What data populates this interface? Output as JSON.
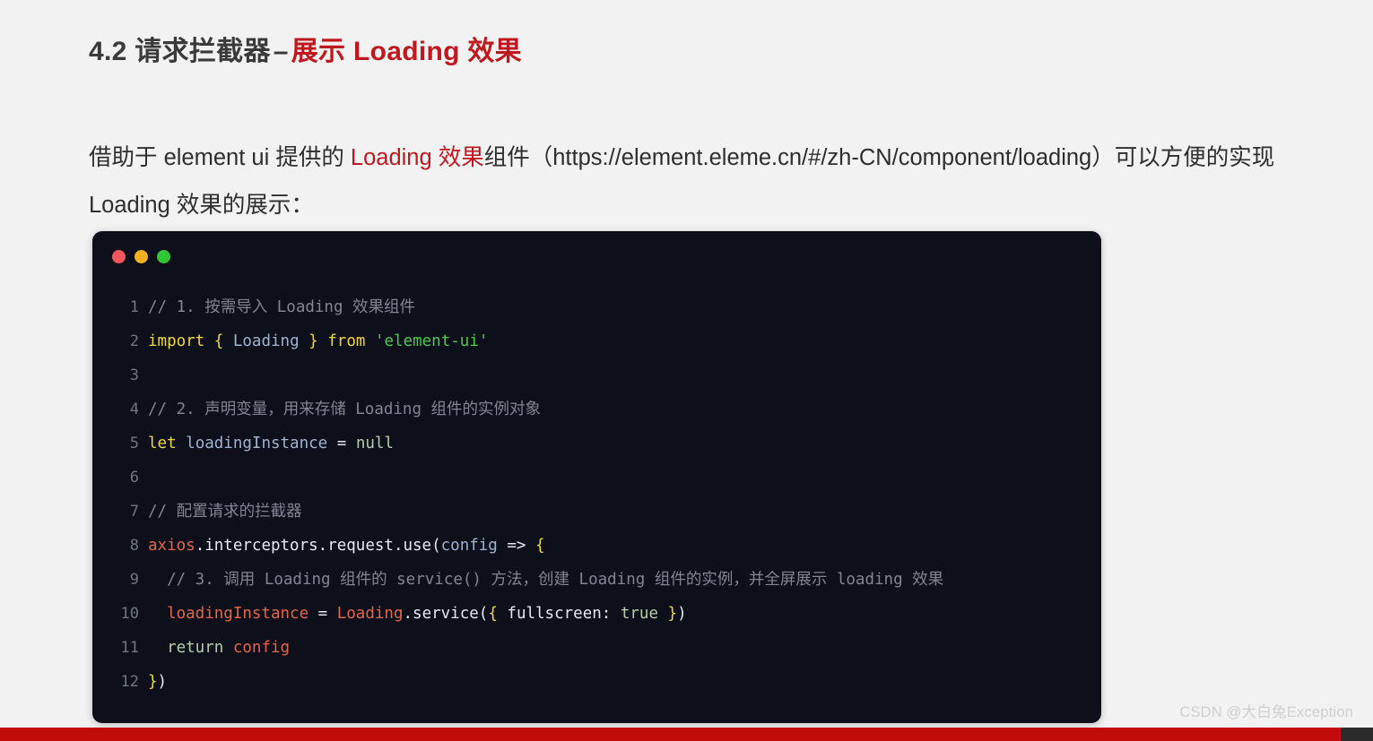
{
  "page": {
    "background_color": "#f2f2f2",
    "accent_color": "#c0181f"
  },
  "heading": {
    "prefix": "4.2 请求拦截器",
    "dash": "–",
    "accent": "展示 Loading 效果"
  },
  "paragraph": {
    "part1": "借助于 element ui 提供的 ",
    "accent": "Loading 效果",
    "part2": "组件（https://element.eleme.cn/#/zh-CN/component/loading）可以方便的实现 Loading 效果的展示：",
    "url": "https://element.eleme.cn/#/zh-CN/component/loading"
  },
  "code_card": {
    "background_color": "#0d101b",
    "window_dots": [
      {
        "name": "close-dot",
        "color": "#f2565c"
      },
      {
        "name": "minimize-dot",
        "color": "#f5b01f"
      },
      {
        "name": "maximize-dot",
        "color": "#2fc636"
      }
    ],
    "language": "javascript",
    "lines": [
      {
        "n": "1",
        "text": "// 1. 按需导入 Loading 效果组件"
      },
      {
        "n": "2",
        "text": "import { Loading } from 'element-ui'"
      },
      {
        "n": "3",
        "text": ""
      },
      {
        "n": "4",
        "text": "// 2. 声明变量，用来存储 Loading 组件的实例对象"
      },
      {
        "n": "5",
        "text": "let loadingInstance = null"
      },
      {
        "n": "6",
        "text": ""
      },
      {
        "n": "7",
        "text": "// 配置请求的拦截器"
      },
      {
        "n": "8",
        "text": "axios.interceptors.request.use(config => {"
      },
      {
        "n": "9",
        "text": "  // 3. 调用 Loading 组件的 service() 方法，创建 Loading 组件的实例，并全屏展示 loading 效果"
      },
      {
        "n": "10",
        "text": "  loadingInstance = Loading.service({ fullscreen: true })"
      },
      {
        "n": "11",
        "text": "  return config"
      },
      {
        "n": "12",
        "text": "})"
      }
    ]
  },
  "watermark": {
    "text": "CSDN @大白兔Exception"
  },
  "bottom_bar": {
    "color": "#c20c0c"
  }
}
